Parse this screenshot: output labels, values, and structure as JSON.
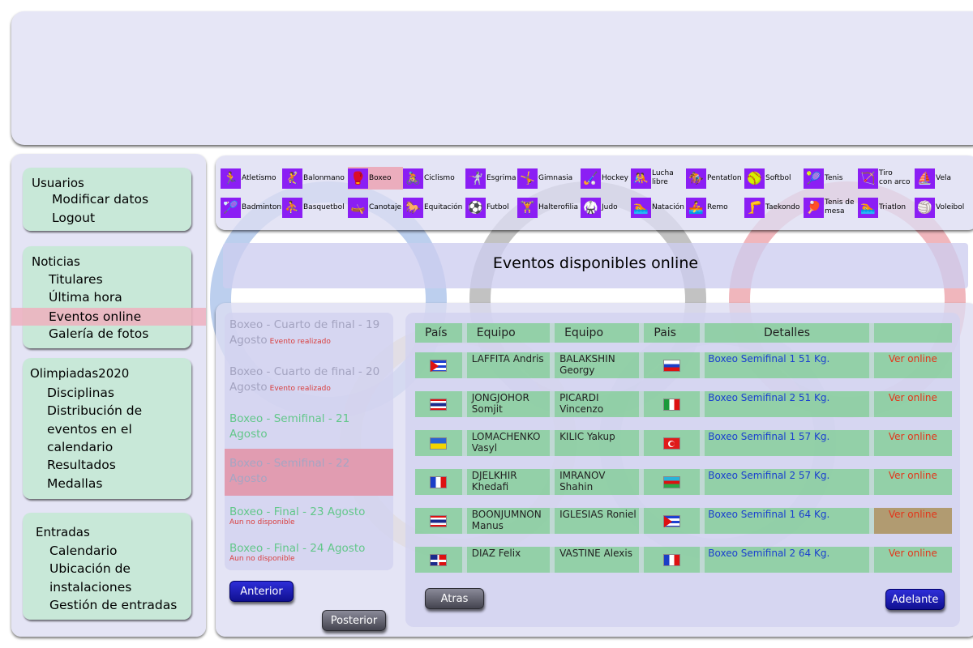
{
  "menu": {
    "usuarios": {
      "title": "Usuarios",
      "items": [
        "Modificar datos",
        "Logout"
      ]
    },
    "noticias": {
      "title": "Noticias",
      "items": [
        "Titulares",
        "Última hora",
        "Eventos online",
        "Galería de fotos"
      ]
    },
    "olimpiadas": {
      "title": "Olimpiadas2020",
      "items": [
        "Disciplinas",
        "Distribución de",
        "eventos en el",
        "calendario",
        "Resultados",
        "Medallas"
      ]
    },
    "entradas": {
      "title": "Entradas",
      "items": [
        "Calendario",
        "Ubicación de",
        "instalaciones",
        "Gestión de entradas"
      ]
    }
  },
  "sports_row1": [
    {
      "label": "Atletismo",
      "icon": "athletics-icon",
      "glyph": "🏃"
    },
    {
      "label": "Balonmano",
      "icon": "handball-icon",
      "glyph": "🤾"
    },
    {
      "label": "Boxeo",
      "icon": "boxing-icon",
      "glyph": "🥊"
    },
    {
      "label": "Ciclismo",
      "icon": "cycling-icon",
      "glyph": "🚴"
    },
    {
      "label": "Esgrima",
      "icon": "fencing-icon",
      "glyph": "🤺"
    },
    {
      "label": "Gimnasia",
      "icon": "gymnastics-icon",
      "glyph": "🤸"
    },
    {
      "label": "Hockey",
      "icon": "hockey-icon",
      "glyph": "🏑"
    },
    {
      "label": "Lucha\nlibre",
      "icon": "wrestling-icon",
      "glyph": "🤼"
    },
    {
      "label": "Pentatlon",
      "icon": "pentathlon-icon",
      "glyph": "🏇"
    },
    {
      "label": "Softbol",
      "icon": "softball-icon",
      "glyph": "🥎"
    },
    {
      "label": "Tenis",
      "icon": "tennis-icon",
      "glyph": "🎾"
    },
    {
      "label": "Tiro\ncon arco",
      "icon": "archery-icon",
      "glyph": "🏹"
    },
    {
      "label": "Vela",
      "icon": "sailing-icon",
      "glyph": "⛵"
    }
  ],
  "sports_row2": [
    {
      "label": "Badminton",
      "icon": "badminton-icon",
      "glyph": "🏸"
    },
    {
      "label": "Basquetbol",
      "icon": "basketball-icon",
      "glyph": "⛹"
    },
    {
      "label": "Canotaje",
      "icon": "canoeing-icon",
      "glyph": "🛶"
    },
    {
      "label": "Equitación",
      "icon": "equestrian-icon",
      "glyph": "🐎"
    },
    {
      "label": "Futbol",
      "icon": "football-icon",
      "glyph": "⚽"
    },
    {
      "label": "Halterofilia",
      "icon": "weightlifting-icon",
      "glyph": "🏋"
    },
    {
      "label": "Judo",
      "icon": "judo-icon",
      "glyph": "🥋"
    },
    {
      "label": "Natación",
      "icon": "swimming-icon",
      "glyph": "🏊"
    },
    {
      "label": "Remo",
      "icon": "rowing-icon",
      "glyph": "🚣"
    },
    {
      "label": "Taekondo",
      "icon": "taekwondo-icon",
      "glyph": "🦵"
    },
    {
      "label": "Tenis de\nmesa",
      "icon": "table-tennis-icon",
      "glyph": "🏓"
    },
    {
      "label": "Triatlon",
      "icon": "triathlon-icon",
      "glyph": "🏊"
    },
    {
      "label": "Voleibol",
      "icon": "volleyball-icon",
      "glyph": "🏐"
    }
  ],
  "page_title": "Eventos disponibles online",
  "events": [
    {
      "title": "Boxeo - Cuarto de final - 19 Agosto",
      "status": "Evento realizado",
      "state": "past"
    },
    {
      "title": "Boxeo - Cuarto de final - 20 Agosto",
      "status": "Evento realizado",
      "state": "past"
    },
    {
      "title": "Boxeo - Semifinal - 21 Agosto",
      "status": "",
      "state": "available"
    },
    {
      "title": "Boxeo - Semifinal - 22 Agosto",
      "status": "",
      "state": "selected"
    },
    {
      "title": "Boxeo - Final - 23 Agosto",
      "status": "Aun no disponible",
      "state": "future"
    },
    {
      "title": "Boxeo - Final - 24 Agosto",
      "status": "Aun no disponible",
      "state": "future"
    }
  ],
  "table": {
    "headers": [
      "País",
      "Equipo",
      "Equipo",
      "Pais",
      "Detalles",
      ""
    ],
    "rows": [
      {
        "flag1": "cuba",
        "team1": "LAFFITA Andris",
        "team2": "BALAKSHIN Georgy",
        "flag2": "russia",
        "details": "Boxeo Semifinal 1 51 Kg.",
        "action": "Ver online"
      },
      {
        "flag1": "thailand",
        "team1": "JONGJOHOR Somjit",
        "team2": "PICARDI Vincenzo",
        "flag2": "italy",
        "details": "Boxeo Semifinal 2 51 Kg.",
        "action": "Ver online"
      },
      {
        "flag1": "ukraine",
        "team1": "LOMACHENKO Vasyl",
        "team2": "KILIC Yakup",
        "flag2": "turkey",
        "details": "Boxeo Semifinal 1 57 Kg.",
        "action": "Ver online"
      },
      {
        "flag1": "france",
        "team1": "DJELKHIR Khedafi",
        "team2": "IMRANOV Shahin",
        "flag2": "azerbaijan",
        "details": "Boxeo Semifinal 2 57 Kg.",
        "action": "Ver online"
      },
      {
        "flag1": "thailand",
        "team1": "BOONJUMNON Manus",
        "team2": "IGLESIAS Roniel",
        "flag2": "cuba",
        "details": "Boxeo Semifinal 1 64 Kg.",
        "action": "Ver online"
      },
      {
        "flag1": "dominican-republic",
        "team1": "DIAZ Felix",
        "team2": "VASTINE Alexis",
        "flag2": "france",
        "details": "Boxeo Semifinal 2 64 Kg.",
        "action": "Ver online"
      }
    ]
  },
  "buttons": {
    "anterior": "Anterior",
    "posterior": "Posterior",
    "atras": "Atras",
    "adelante": "Adelante"
  },
  "colors": {
    "sport_icon_bg": "#8b1ef4",
    "menu_box_bg": "#c4e8d5",
    "highlight": "#eeb0be",
    "table_cell": "#78cd8c",
    "link_blue": "#1a3fcf",
    "action_red": "#e3351a"
  }
}
